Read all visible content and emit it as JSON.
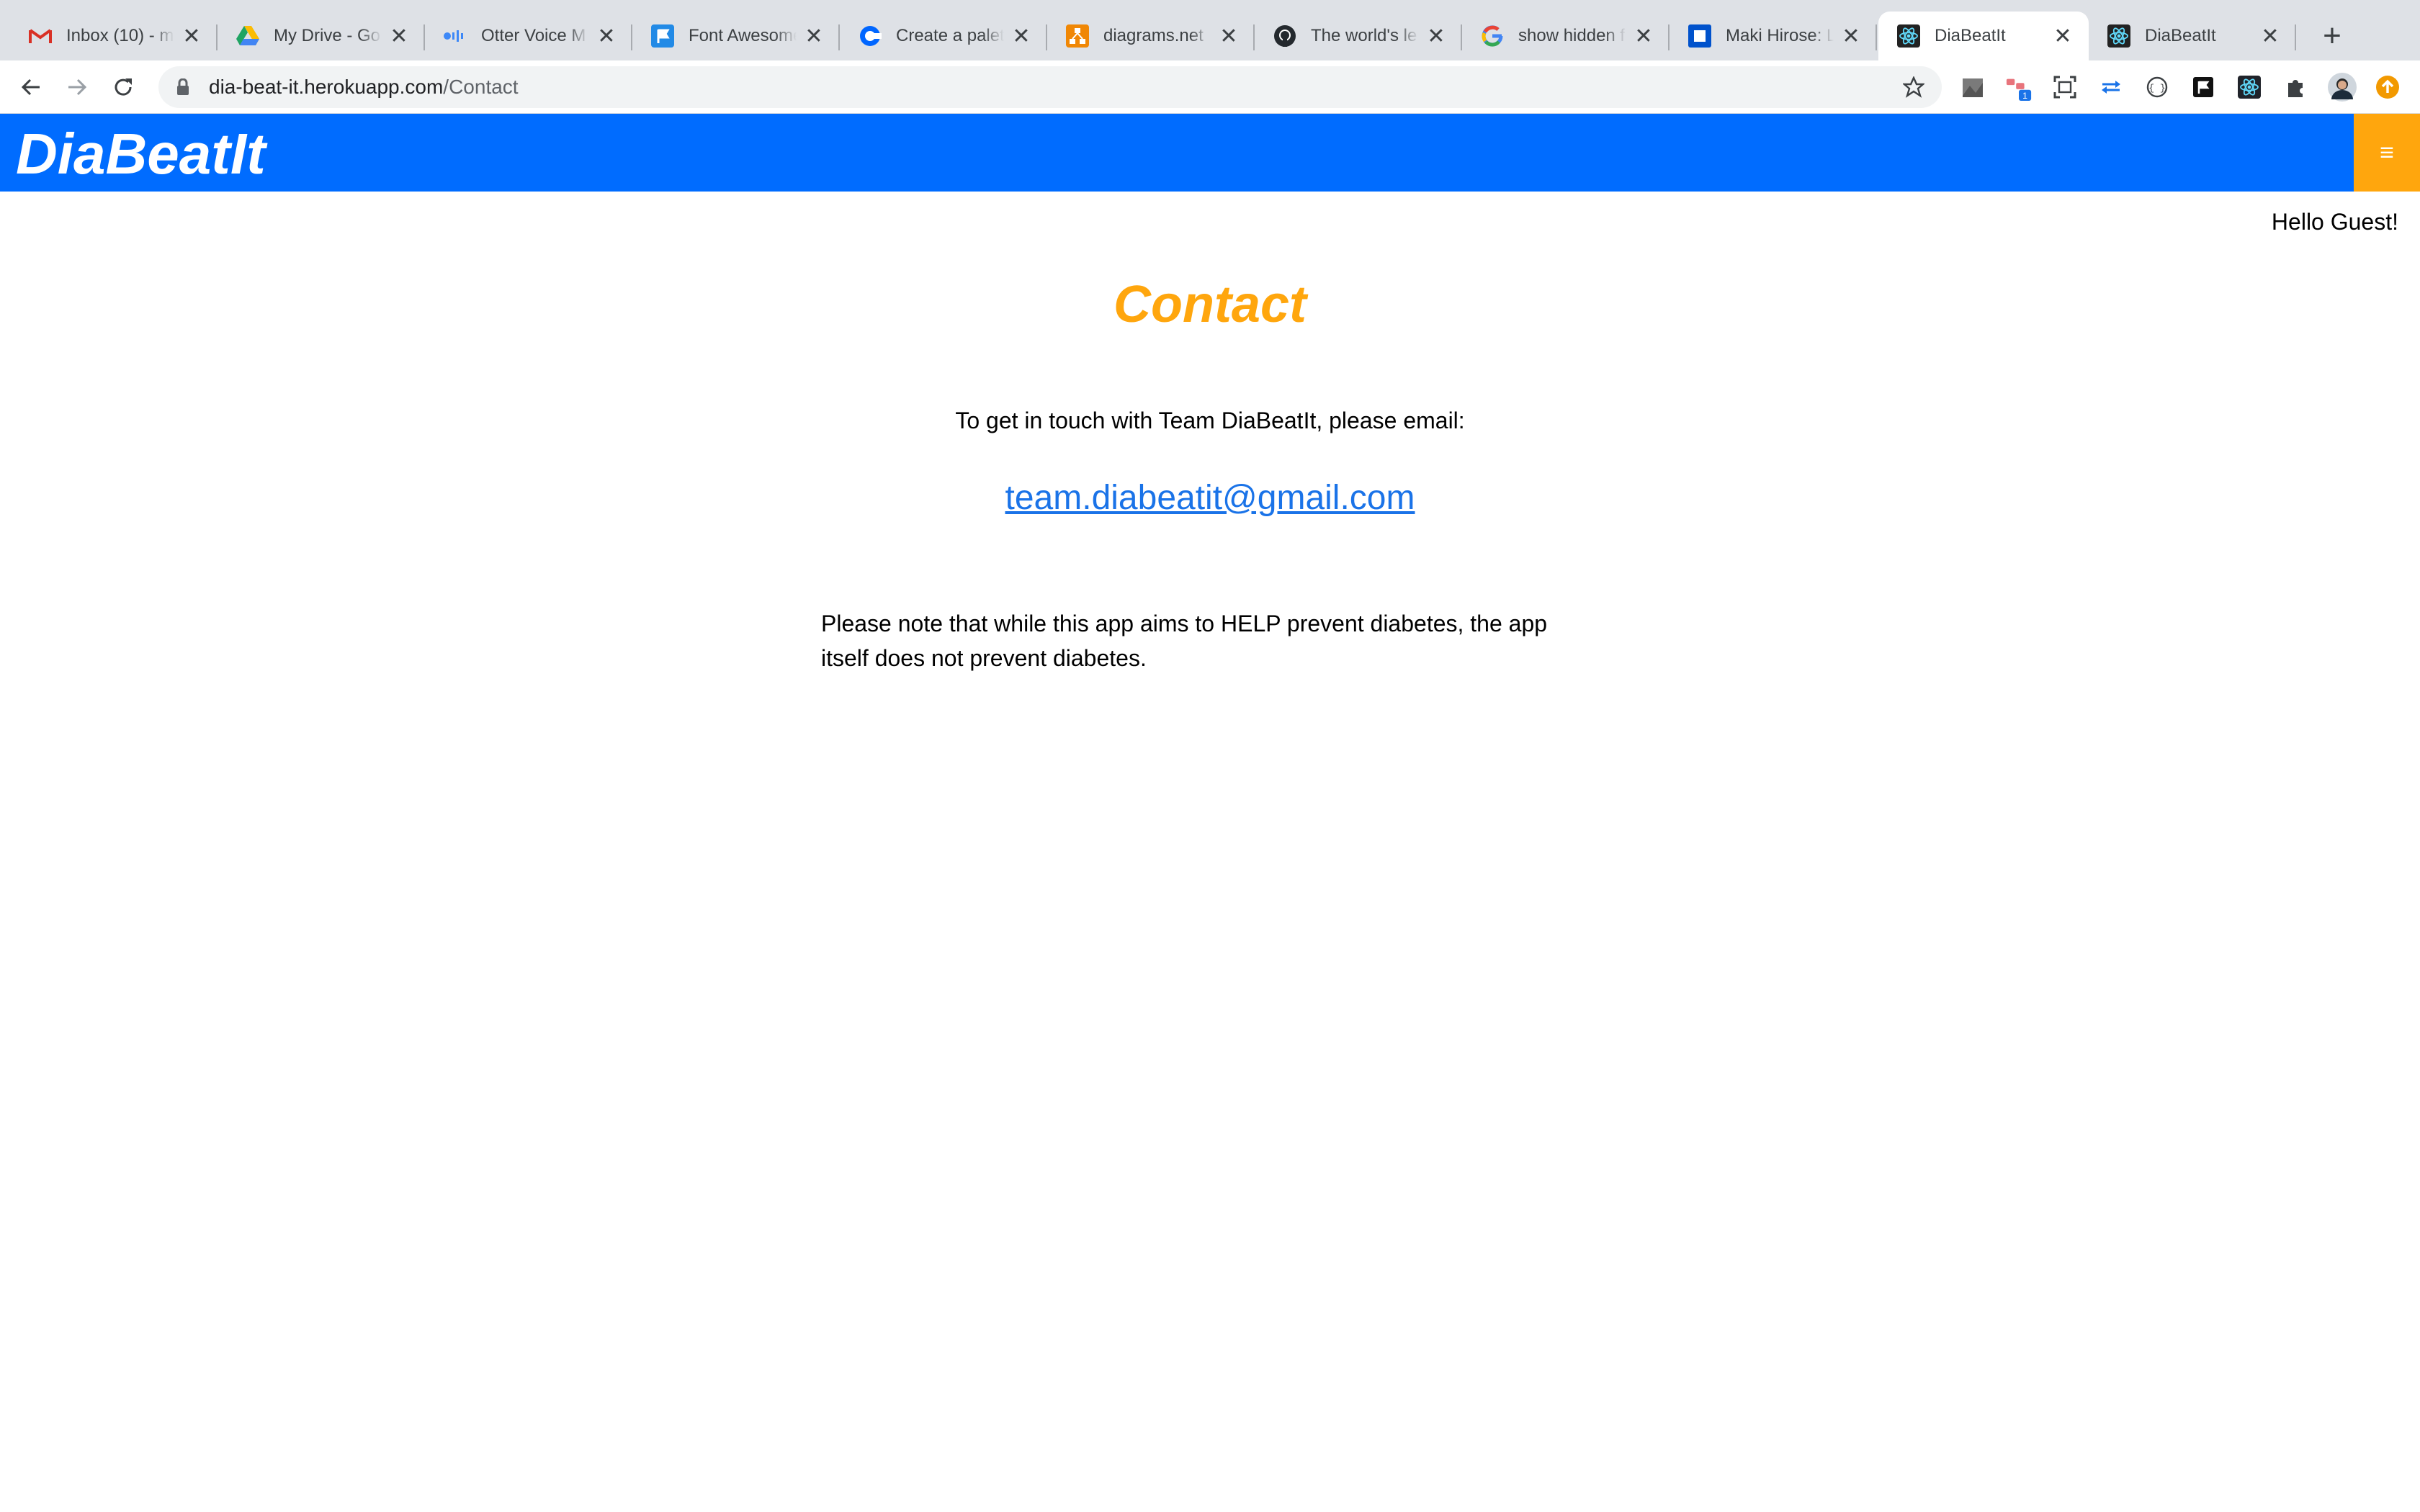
{
  "browser": {
    "tabs": [
      {
        "title": "Inbox (10) - m",
        "icon": "gmail-icon"
      },
      {
        "title": "My Drive - Go",
        "icon": "google-drive-icon"
      },
      {
        "title": "Otter Voice M",
        "icon": "otter-icon"
      },
      {
        "title": "Font Awesome",
        "icon": "font-awesome-icon"
      },
      {
        "title": "Create a palet",
        "icon": "coolors-icon"
      },
      {
        "title": "diagrams.net",
        "icon": "diagrams-icon"
      },
      {
        "title": "The world's le",
        "icon": "github-icon"
      },
      {
        "title": "show hidden f",
        "icon": "google-icon"
      },
      {
        "title": "Maki Hirose: L",
        "icon": "trello-icon"
      },
      {
        "title": "DiaBeatIt",
        "icon": "react-icon",
        "active": true
      },
      {
        "title": "DiaBeatIt",
        "icon": "react-icon"
      }
    ],
    "url_host": "dia-beat-it.herokuapp.com",
    "url_path": "/Contact",
    "extension_badge": "1"
  },
  "app": {
    "brand": "DiaBeatIt",
    "greeting": "Hello Guest!",
    "menu_icon": "≡"
  },
  "contact": {
    "title": "Contact",
    "intro": "To get in touch with Team DiaBeatIt, please email:",
    "email": "team.diabeatit@gmail.com",
    "note": "Please note that while this app aims to HELP prevent diabetes, the app itself does not prevent diabetes."
  },
  "colors": {
    "header": "#006cff",
    "accent": "#ffa60d",
    "link": "#1a73e8"
  }
}
